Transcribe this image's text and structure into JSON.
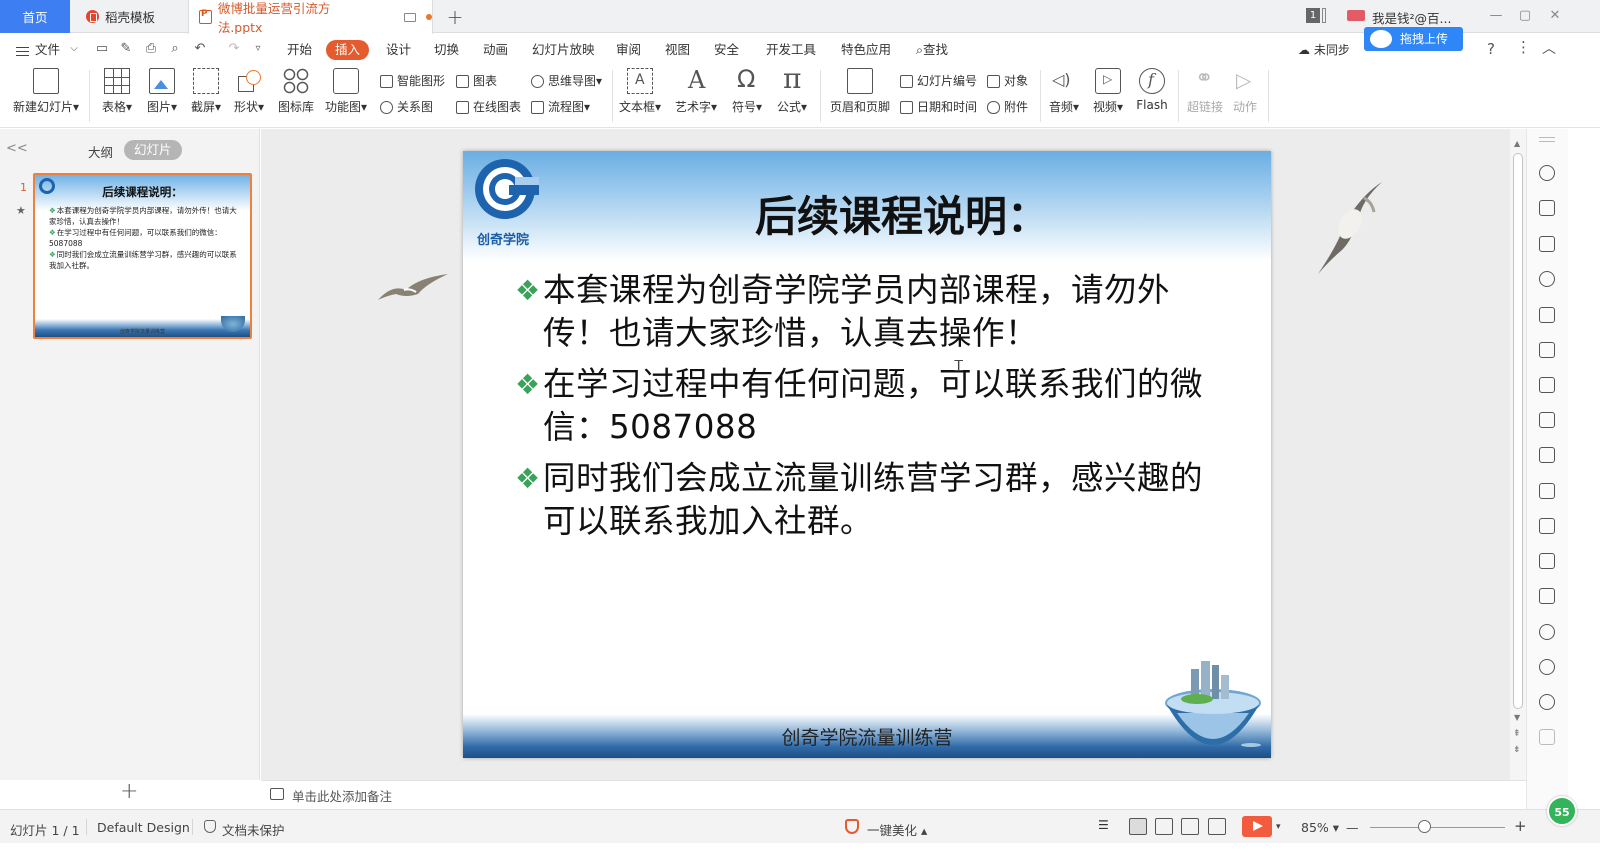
{
  "tabs": {
    "home": "首页",
    "docer": "稻壳模板",
    "file": "微博批量运营引流方法.pptx",
    "new": "+"
  },
  "titlebar": {
    "page_badge": "1",
    "user_name": "我是钱²@百...",
    "min": "—",
    "max": "▢",
    "close": "✕"
  },
  "menu": {
    "file": "文件",
    "items": [
      "开始",
      "插入",
      "设计",
      "切换",
      "动画",
      "幻灯片放映",
      "审阅",
      "视图",
      "安全",
      "开发工具",
      "特色应用"
    ],
    "active": "插入",
    "search": "查找",
    "sync": "未同步",
    "upload": "拖拽上传",
    "help": "?",
    "more": "⋮",
    "collapse": "︿"
  },
  "ribbon": {
    "new_slide": "新建幻灯片",
    "table": "表格",
    "image": "图片",
    "screenshot": "截屏",
    "shape": "形状",
    "icon_lib": "图标库",
    "function_chart": "功能图",
    "smart_art": "智能图形",
    "chart": "图表",
    "relation": "关系图",
    "online_chart": "在线图表",
    "mind_map": "思维导图",
    "flowchart": "流程图",
    "textbox": "文本框",
    "word_art": "艺术字",
    "symbol": "符号",
    "formula": "公式",
    "header_footer": "页眉和页脚",
    "slide_number": "幻灯片编号",
    "object": "对象",
    "date_time": "日期和时间",
    "attachment": "附件",
    "audio": "音频",
    "video": "视频",
    "flash": "Flash",
    "hyperlink": "超链接",
    "action": "动作"
  },
  "left_panel": {
    "collapse": "<<",
    "outline_tab": "大纲",
    "slides_tab": "幻灯片",
    "slide_number": "1",
    "star": "★",
    "add": "+"
  },
  "slide": {
    "logo_text": "创奇学院",
    "title": "后续课程说明：",
    "bullets": [
      "本套课程为创奇学院学员内部课程，请勿外传！也请大家珍惜，认真去操作！",
      "在学习过程中有任何问题，可以联系我们的微信：5087088",
      "同时我们会成立流量训练营学习群，感兴趣的可以联系我加入社群。"
    ],
    "footer": "创奇学院流量训练营",
    "thumb_footer": "创奇学院流量训练营"
  },
  "notes": {
    "placeholder": "单击此处添加备注"
  },
  "status": {
    "slide_count": "幻灯片 1 / 1",
    "theme": "Default Design",
    "protection": "文档未保护",
    "beautify": "一键美化",
    "zoom": "85%",
    "zoom_minus": "—",
    "zoom_plus": "+",
    "badge": "55"
  },
  "colors": {
    "accent_tab": "#3d7ff2",
    "active_menu": "#e35b2e",
    "bullet_marker": "#3aa35a",
    "play": "#f25b3e"
  }
}
